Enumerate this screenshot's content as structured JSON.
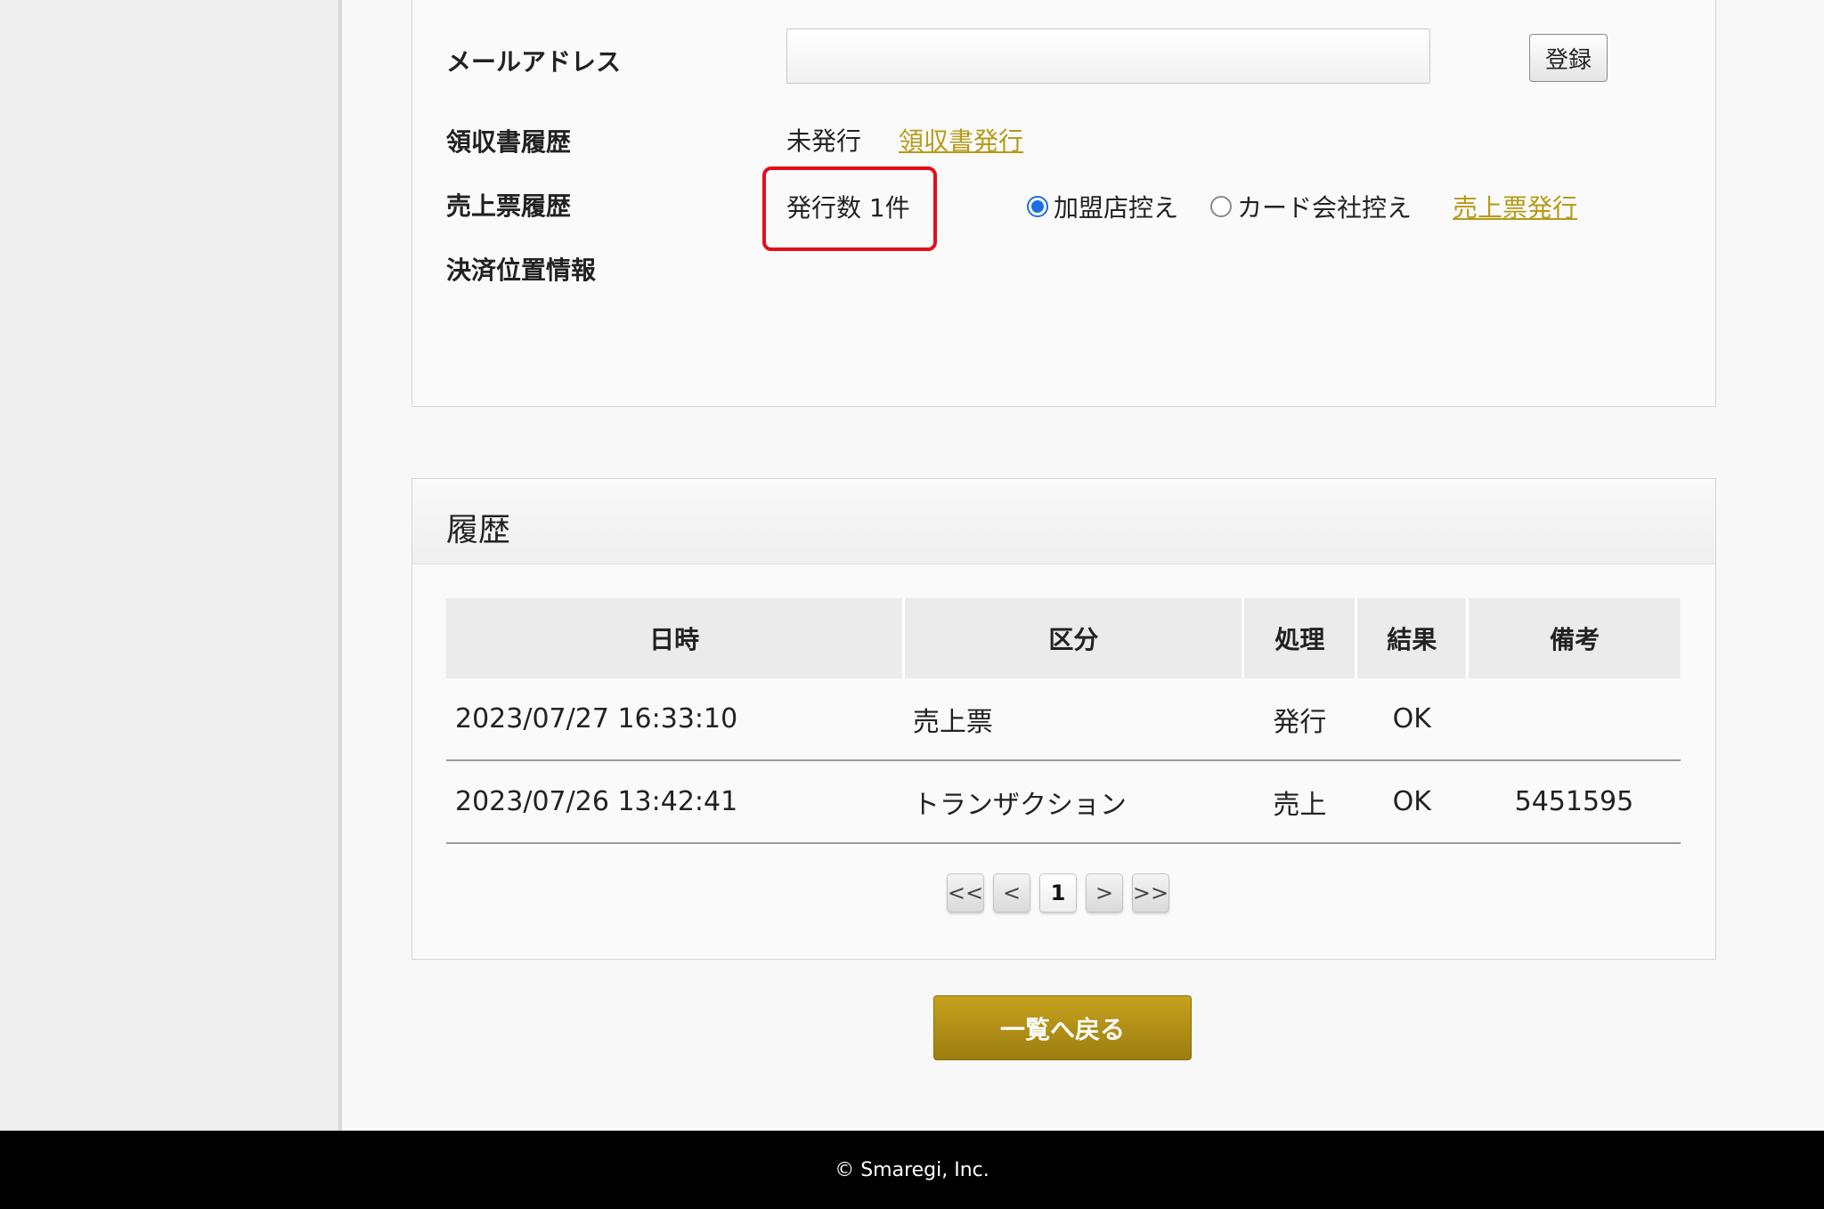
{
  "form": {
    "email_label": "メールアドレス",
    "email_value": "",
    "register_button": "登録",
    "receipt_history_label": "領収書履歴",
    "receipt_status": "未発行",
    "receipt_issue_link": "領収書発行",
    "sales_slip_history_label": "売上票履歴",
    "sales_slip_count": "発行数 1件",
    "copy_options": [
      {
        "label": "加盟店控え",
        "checked": true
      },
      {
        "label": "カード会社控え",
        "checked": false
      }
    ],
    "sales_slip_issue_link": "売上票発行",
    "payment_location_label": "決済位置情報"
  },
  "history": {
    "title": "履歴",
    "columns": [
      "日時",
      "区分",
      "処理",
      "結果",
      "備考"
    ],
    "rows": [
      {
        "datetime": "2023/07/27 16:33:10",
        "category": "売上票",
        "process": "発行",
        "result": "OK",
        "note": ""
      },
      {
        "datetime": "2023/07/26 13:42:41",
        "category": "トランザクション",
        "process": "売上",
        "result": "OK",
        "note": "5451595"
      }
    ],
    "pagination": {
      "first": "<<",
      "prev": "<",
      "current": "1",
      "next": ">",
      "last": ">>"
    }
  },
  "back_button": "一覧へ戻る",
  "footer": {
    "copyright": "© Smaregi, Inc."
  },
  "colors": {
    "accent_gold": "#b59b18",
    "highlight_red": "#e10f1c",
    "radio_blue": "#1b6ee8"
  }
}
